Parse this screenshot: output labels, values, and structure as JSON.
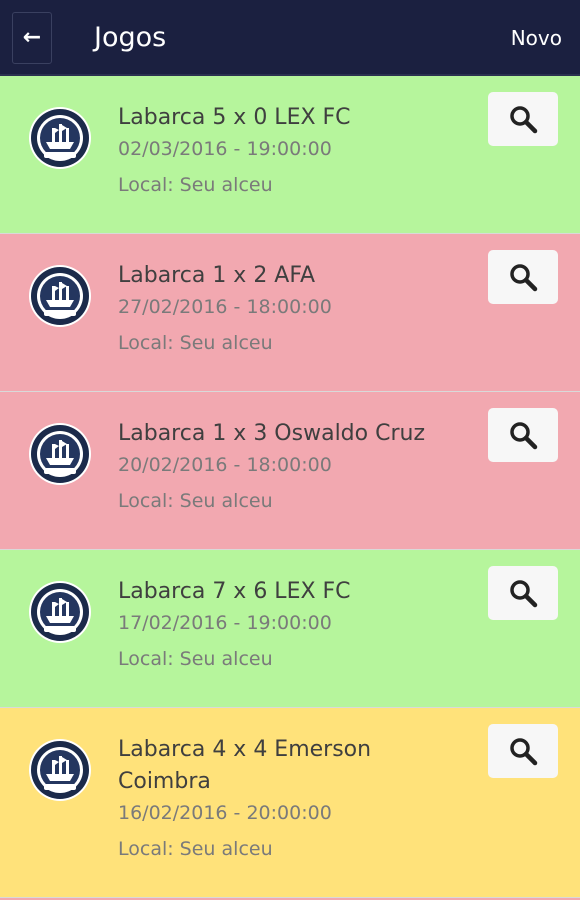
{
  "header": {
    "back_icon": "arrow-left-icon",
    "title": "Jogos",
    "new_label": "Novo",
    "background": "#1b2040"
  },
  "colors": {
    "win": "#b6f59c",
    "loss": "#f2a8b0",
    "draw": "#ffe27a"
  },
  "games": [
    {
      "match": "Labarca 5 x 0 LEX FC",
      "datetime": "02/03/2016 - 19:00:00",
      "local": "Local: Seu alceu",
      "result": "win",
      "icon": "search-icon"
    },
    {
      "match": "Labarca 1 x 2 AFA",
      "datetime": "27/02/2016 - 18:00:00",
      "local": "Local: Seu alceu",
      "result": "loss",
      "icon": "search-icon"
    },
    {
      "match": "Labarca 1 x 3 Oswaldo Cruz",
      "datetime": "20/02/2016 - 18:00:00",
      "local": "Local: Seu alceu",
      "result": "loss",
      "icon": "search-icon"
    },
    {
      "match": "Labarca 7 x 6 LEX FC",
      "datetime": "17/02/2016 - 19:00:00",
      "local": "Local: Seu alceu",
      "result": "win",
      "icon": "search-icon"
    },
    {
      "match": "Labarca 4 x 4 Emerson Coimbra",
      "datetime": "16/02/2016 - 20:00:00",
      "local": "Local: Seu alceu",
      "result": "draw",
      "icon": "search-icon"
    }
  ],
  "partial_next_item": {
    "result": "loss"
  }
}
